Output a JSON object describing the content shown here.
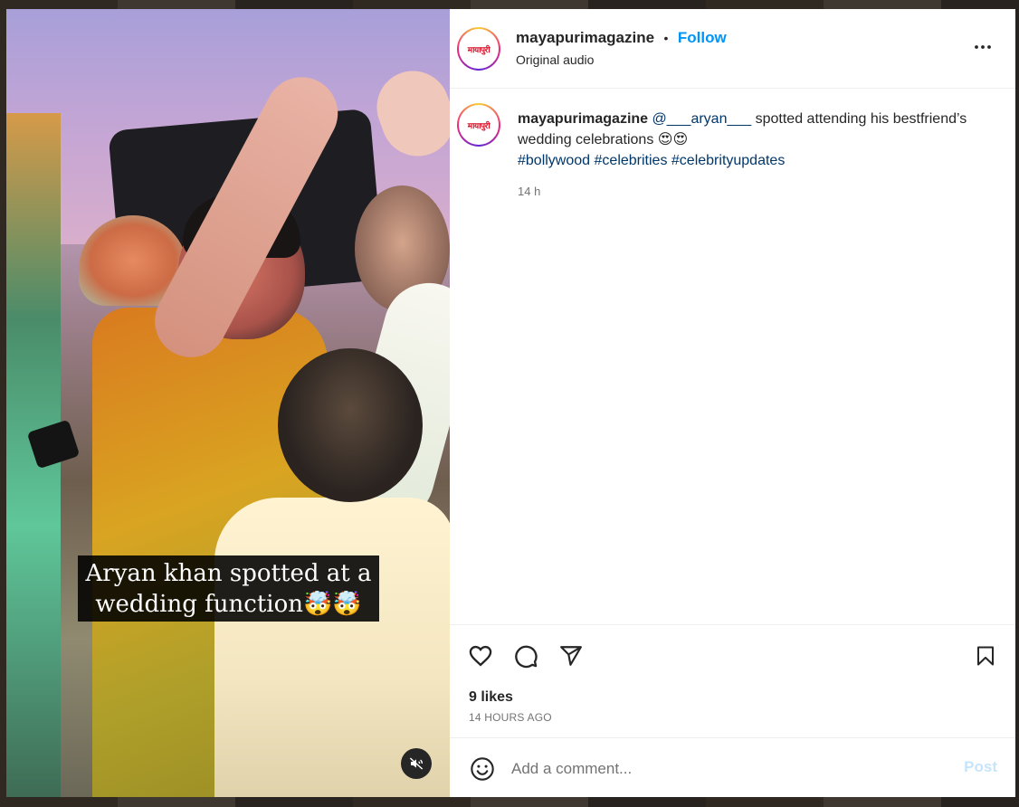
{
  "video": {
    "caption_line1": "Aryan khan spotted at a",
    "caption_line2": "wedding function🤯🤯",
    "mute_icon": "speaker-muted-icon"
  },
  "header": {
    "avatar_text": "मायापुरी",
    "username": "mayapurimagazine",
    "separator": "•",
    "follow_label": "Follow",
    "subtitle": "Original audio",
    "more_icon": "more-horizontal-icon"
  },
  "caption": {
    "username": "mayapurimagazine",
    "mention": "@___aryan___",
    "text": " spotted attending his bestfriend’s wedding celebrations 😍😍",
    "hashtags": [
      "#bollywood",
      "#celebrities",
      "#celebrityupdates"
    ],
    "time": "14 h"
  },
  "actions": {
    "like_icon": "heart-icon",
    "comment_icon": "comment-bubble-icon",
    "share_icon": "paper-plane-icon",
    "save_icon": "bookmark-icon",
    "likes": "9 likes",
    "ago": "14 HOURS AGO"
  },
  "comment_bar": {
    "emoji_icon": "smiley-icon",
    "placeholder": "Add a comment...",
    "post_label": "Post"
  },
  "colors": {
    "follow": "#0095f6",
    "link": "#00376b",
    "muted_text": "#737373",
    "post_disabled": "#c6e5fb"
  }
}
